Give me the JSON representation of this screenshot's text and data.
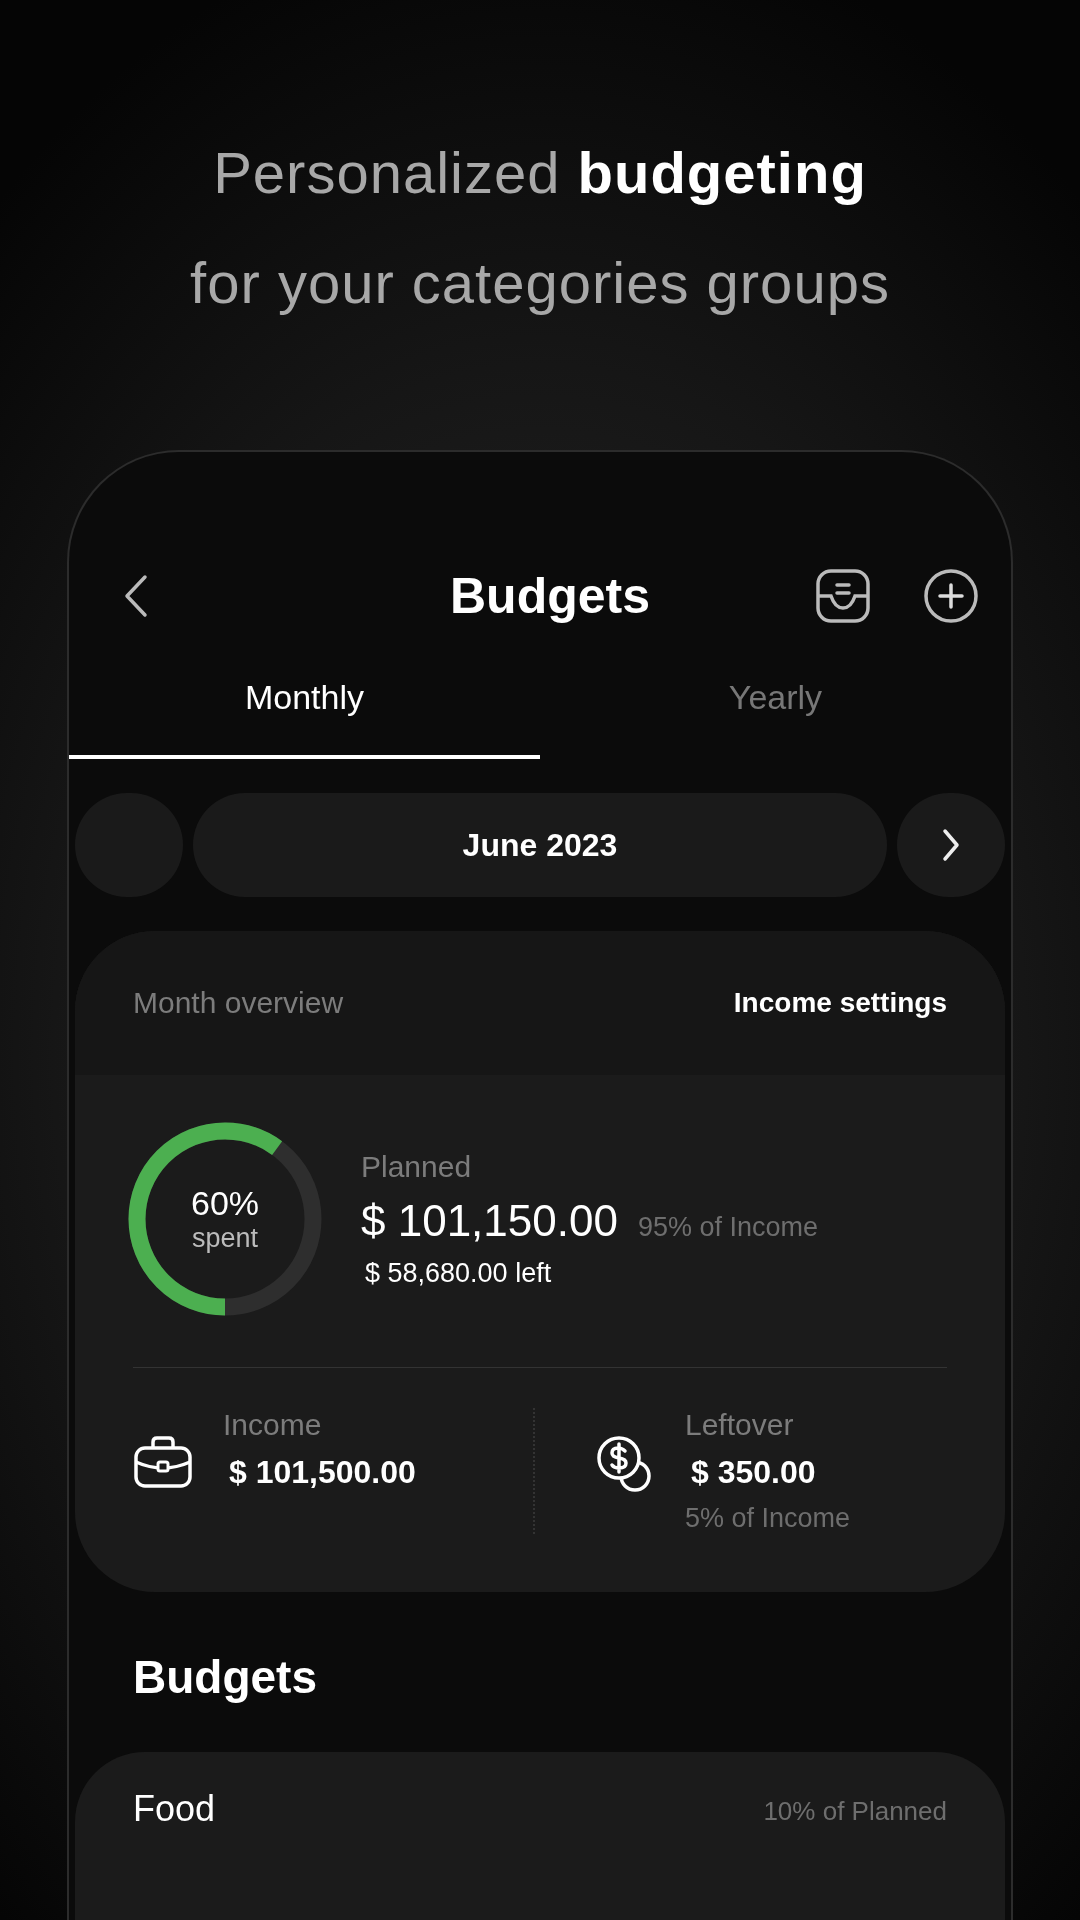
{
  "headline_lines": [
    "Personalized **budgeting**",
    "for your categories groups"
  ],
  "header": {
    "title": "Budgets"
  },
  "tabs": [
    {
      "label": "Monthly",
      "selected": true
    },
    {
      "label": "Yearly",
      "selected": false
    }
  ],
  "period": {
    "label": "June 2023"
  },
  "overview": {
    "title": "Month overview",
    "action": "Income settings",
    "level": 0.6,
    "percent": "60%",
    "percent_caption": "spent",
    "planned_label": "Planned",
    "planned_amount": "$ 101,150.00",
    "planned_share": "95% of Income",
    "left": "$ 58,680.00 left",
    "stats": [
      {
        "kind": "income",
        "label": "Income",
        "amount": "$ 101,500.00"
      },
      {
        "kind": "leftover",
        "label": "Leftover",
        "amount": "$ 350.00",
        "note": "5% of Income"
      }
    ]
  },
  "budgets": {
    "title": "Budgets",
    "items": [
      {
        "name": "Food",
        "share": "10% of Planned"
      }
    ]
  }
}
